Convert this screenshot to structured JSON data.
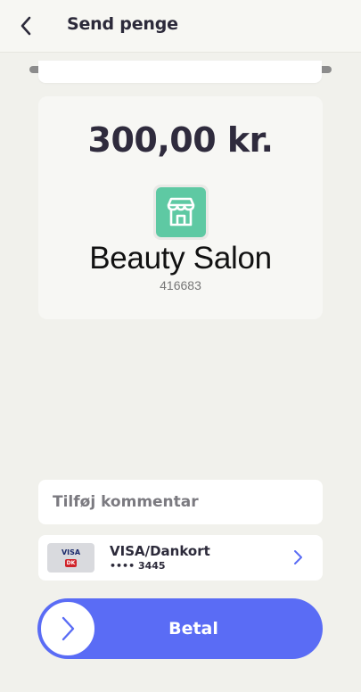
{
  "header": {
    "title": "Send penge",
    "back_icon": "chevron-left-icon"
  },
  "payment": {
    "amount": "300,00 kr."
  },
  "merchant": {
    "icon": "store-icon",
    "icon_color": "#5ec9a3",
    "name": "Beauty Salon",
    "id": "416683"
  },
  "comment": {
    "placeholder": "Tilføj kommentar"
  },
  "card": {
    "logo_visa": "VISA",
    "logo_dk": "DK",
    "name": "VISA/Dankort",
    "number": "•••• 3445",
    "chevron_icon": "chevron-right-icon"
  },
  "pay_button": {
    "label": "Betal",
    "knob_icon": "chevron-right-icon",
    "color": "#5a6cf5"
  }
}
